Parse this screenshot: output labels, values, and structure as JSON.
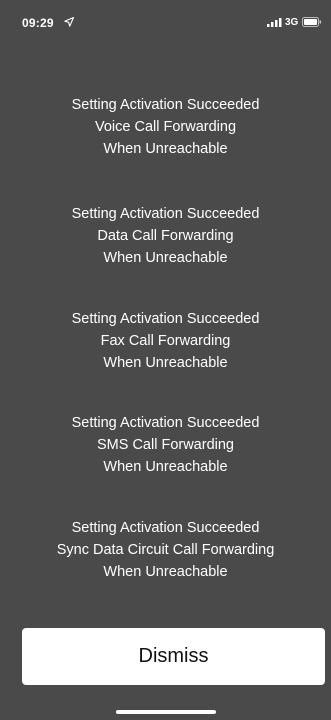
{
  "status_bar": {
    "time": "09:29",
    "network": "3G",
    "icons": [
      "location-arrow-icon",
      "cellular-signal-icon",
      "battery-icon"
    ]
  },
  "messages": [
    {
      "status": "Setting Activation Succeeded",
      "service": "Voice Call Forwarding",
      "condition": "When Unreachable"
    },
    {
      "status": "Setting Activation Succeeded",
      "service": "Data Call Forwarding",
      "condition": "When Unreachable"
    },
    {
      "status": "Setting Activation Succeeded",
      "service": "Fax Call Forwarding",
      "condition": "When Unreachable"
    },
    {
      "status": "Setting Activation Succeeded",
      "service": "SMS Call Forwarding",
      "condition": "When Unreachable"
    },
    {
      "status": "Setting Activation Succeeded",
      "service": "Sync Data Circuit Call Forwarding",
      "condition": "When Unreachable"
    }
  ],
  "dismiss_label": "Dismiss",
  "colors": {
    "background": "#4a4a4a",
    "text": "#ffffff",
    "button_background": "#ffffff",
    "button_text": "#111111"
  }
}
